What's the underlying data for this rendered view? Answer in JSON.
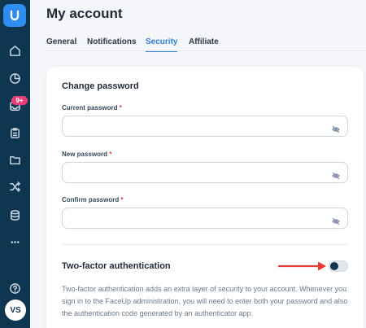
{
  "sidebar": {
    "logo_icon": "brand-logo-icon",
    "items": [
      {
        "icon": "home-icon"
      },
      {
        "icon": "pie-chart-icon"
      },
      {
        "icon": "inbox-icon",
        "badge": "9+"
      },
      {
        "icon": "clipboard-icon"
      },
      {
        "icon": "folder-icon"
      },
      {
        "icon": "shuffle-icon"
      },
      {
        "icon": "database-icon"
      },
      {
        "icon": "more-horizontal-icon"
      }
    ],
    "help_icon": "help-icon",
    "avatar_initials": "VS"
  },
  "header": {
    "title": "My account"
  },
  "tabs": [
    {
      "label": "General",
      "active": false
    },
    {
      "label": "Notifications",
      "active": false
    },
    {
      "label": "Security",
      "active": true
    },
    {
      "label": "Affiliate",
      "active": false
    }
  ],
  "change_password": {
    "title": "Change password",
    "fields": [
      {
        "label": "Current password",
        "required_mark": "*",
        "value": ""
      },
      {
        "label": "New password",
        "required_mark": "*",
        "value": ""
      },
      {
        "label": "Confirm password",
        "required_mark": "*",
        "value": ""
      }
    ]
  },
  "two_factor": {
    "title": "Two-factor authentication",
    "enabled": false,
    "description": "Two-factor authentication adds an extra layer of security to your account. Whenever you sign in to the FaceUp administration, you will need to enter both your password and also the authentication code generated by an authenticator app."
  },
  "colors": {
    "sidebar_bg": "#0f3651",
    "accent": "#2f7fd1",
    "badge": "#e83e7a",
    "required": "#e0344a",
    "annotation_arrow": "#e53935"
  }
}
